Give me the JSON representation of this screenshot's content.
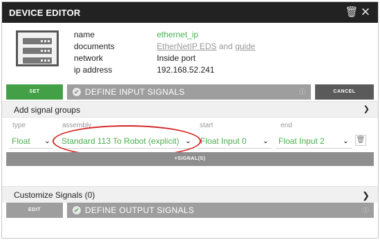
{
  "titlebar": {
    "title": "DEVICE EDITOR",
    "trash_icon": "trash-icon",
    "close_icon": "close-icon"
  },
  "device": {
    "icon": "server-icon",
    "fields": [
      {
        "key": "name",
        "value": "ethernet_ip"
      },
      {
        "key": "documents",
        "value_link1": "EtherNetIP EDS",
        "value_mid": " and ",
        "value_link2": "guide"
      },
      {
        "key": "network",
        "value": "Inside port"
      },
      {
        "key": "ip address",
        "value": "192.168.52.241"
      }
    ]
  },
  "input_section": {
    "set_label": "SET",
    "title": "DEFINE INPUT SIGNALS",
    "cancel_label": "CANCEL"
  },
  "signal_groups": {
    "title": "Add signal groups",
    "columns": {
      "type": "type",
      "assembly": "assembly",
      "start": "start",
      "end": "end"
    },
    "row": {
      "type": "Float",
      "assembly": "Standard 113 To Robot (explicit)",
      "start": "Float Input 0",
      "end": "Float Input 2"
    },
    "add_label": "+SIGNAL(S)"
  },
  "customize": {
    "title": "Customize Signals (0)"
  },
  "output_section": {
    "edit_label": "EDIT",
    "title": "DEFINE OUTPUT SIGNALS"
  },
  "colors": {
    "accent_green": "#43a047",
    "annotation_red": "#d32222"
  }
}
